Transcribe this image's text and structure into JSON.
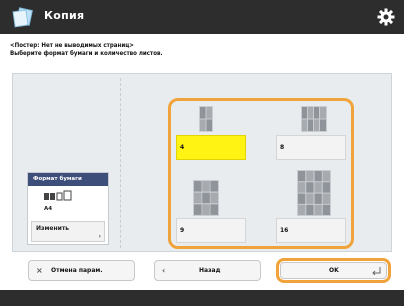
{
  "app": {
    "title": "Копия"
  },
  "message": {
    "line1": "<Постер: Нет не выводимых страниц>",
    "line2": "Выберите формат бумаги и количество листов."
  },
  "paper": {
    "header": "Формат бумаги",
    "size": "A4",
    "change_label": "Изменить"
  },
  "grid": {
    "options": [
      {
        "label": "4",
        "selected": true
      },
      {
        "label": "8",
        "selected": false
      },
      {
        "label": "9",
        "selected": false
      },
      {
        "label": "16",
        "selected": false
      }
    ]
  },
  "buttons": {
    "cancel_label": "Отмена парам.",
    "back_label": "Назад",
    "ok_label": "OK"
  },
  "colors": {
    "accent": "#f0a33a",
    "selected": "#fff314",
    "titlebar": "#2d2d2d"
  }
}
